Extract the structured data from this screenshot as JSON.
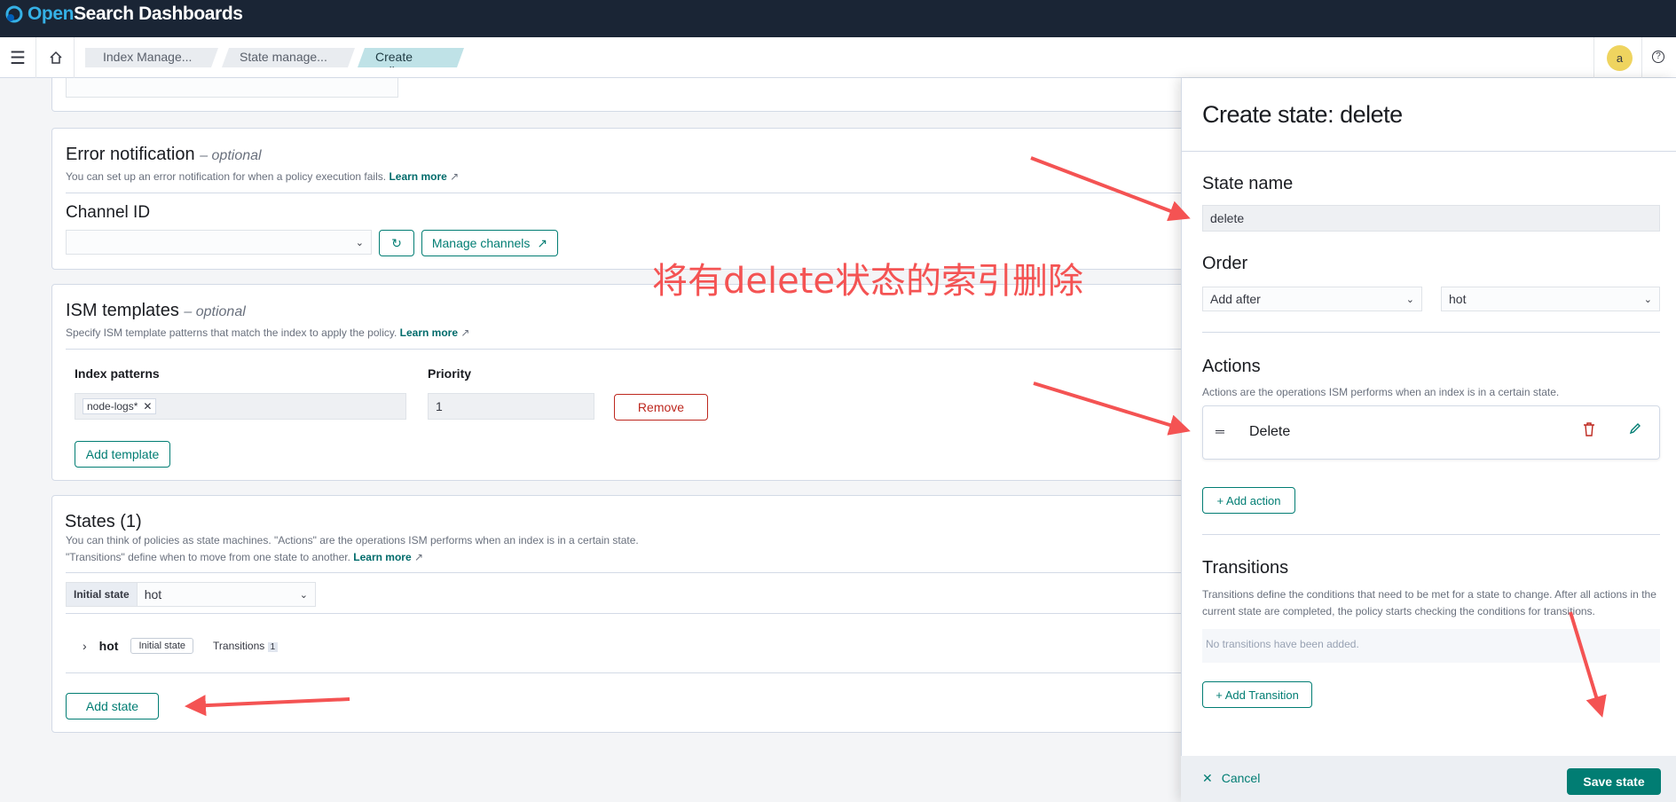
{
  "app": {
    "name_open": "Open",
    "name_rest": "Search Dashboards"
  },
  "breadcrumbs": [
    "Index Manage...",
    "State manage...",
    "Create policy"
  ],
  "avatar": "a",
  "error_notification": {
    "title": "Error notification",
    "optional": "– optional",
    "help": "You can set up an error notification for when a policy execution fails.",
    "learn_more": "Learn more",
    "channel_label": "Channel ID",
    "channel_value": "",
    "manage_channels": "Manage channels"
  },
  "ism_templates": {
    "title": "ISM templates",
    "optional": "– optional",
    "help": "Specify ISM template patterns that match the index to apply the policy.",
    "learn_more": "Learn more",
    "col_index_patterns": "Index patterns",
    "col_priority": "Priority",
    "pattern_chip": "node-logs*",
    "priority_value": "1",
    "remove": "Remove",
    "add_template": "Add template"
  },
  "states": {
    "title": "States (1)",
    "help_line1": "You can think of policies as state machines. \"Actions\" are the operations ISM performs when an index is in a certain state.",
    "help_line2": "\"Transitions\" define when to move from one state to another.",
    "learn_more": "Learn more",
    "initial_state_label": "Initial state",
    "initial_state_value": "hot",
    "rows": [
      {
        "name": "hot",
        "badge": "Initial state",
        "transitions_label": "Transitions",
        "transitions_count": "1"
      }
    ],
    "add_state": "Add state"
  },
  "annotation": "将有delete状态的索引删除",
  "flyout": {
    "title": "Create state: delete",
    "state_name_label": "State name",
    "state_name_value": "delete",
    "order_label": "Order",
    "order_mode": "Add after",
    "order_ref": "hot",
    "actions_title": "Actions",
    "actions_help": "Actions are the operations ISM performs when an index is in a certain state.",
    "action_item": "Delete",
    "add_action": "+ Add action",
    "transitions_title": "Transitions",
    "transitions_help": "Transitions define the conditions that need to be met for a state to change. After all actions in the current state are completed, the policy starts checking the conditions for transitions.",
    "no_transitions": "No transitions have been added.",
    "add_transition": "+ Add Transition",
    "cancel": "Cancel",
    "save": "Save state"
  },
  "colors": {
    "primary": "#017d73",
    "danger": "#bd271e",
    "annotation": "#f45353",
    "header": "#1a2535"
  }
}
